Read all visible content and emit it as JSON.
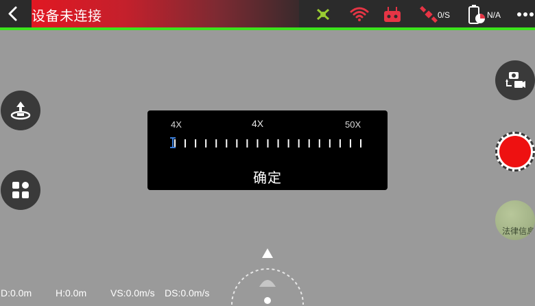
{
  "header": {
    "status_text": "设备未连接",
    "gps_count": "0/S",
    "battery": "N/A"
  },
  "zoom_dialog": {
    "min_label": "4X",
    "current_label": "4X",
    "max_label": "50X",
    "confirm_label": "确定",
    "zoom_level": 4
  },
  "map_thumb": {
    "label": "法律信息"
  },
  "telemetry": {
    "distance": "D:0.0m",
    "height": "H:0.0m",
    "vertical_speed": "VS:0.0m/s",
    "horizontal_speed": "DS:0.0m/s"
  },
  "colors": {
    "status_banner": "#e01822",
    "link_bar": "#3ce31c",
    "shutter": "#ee1111",
    "icon_red": "#e53545",
    "drone_green": "#9acd32",
    "zoom_handle": "#3b7dd8"
  },
  "icons": {
    "back": "chevron-left-icon",
    "drone": "drone-icon",
    "wifi": "wifi-icon",
    "remote": "remote-controller-icon",
    "gps": "satellite-icon",
    "battery": "battery-icon",
    "more": "more-dots-icon",
    "takeoff": "takeoff-icon",
    "menu": "grid-menu-icon",
    "camera_switch": "camera-switch-icon"
  }
}
